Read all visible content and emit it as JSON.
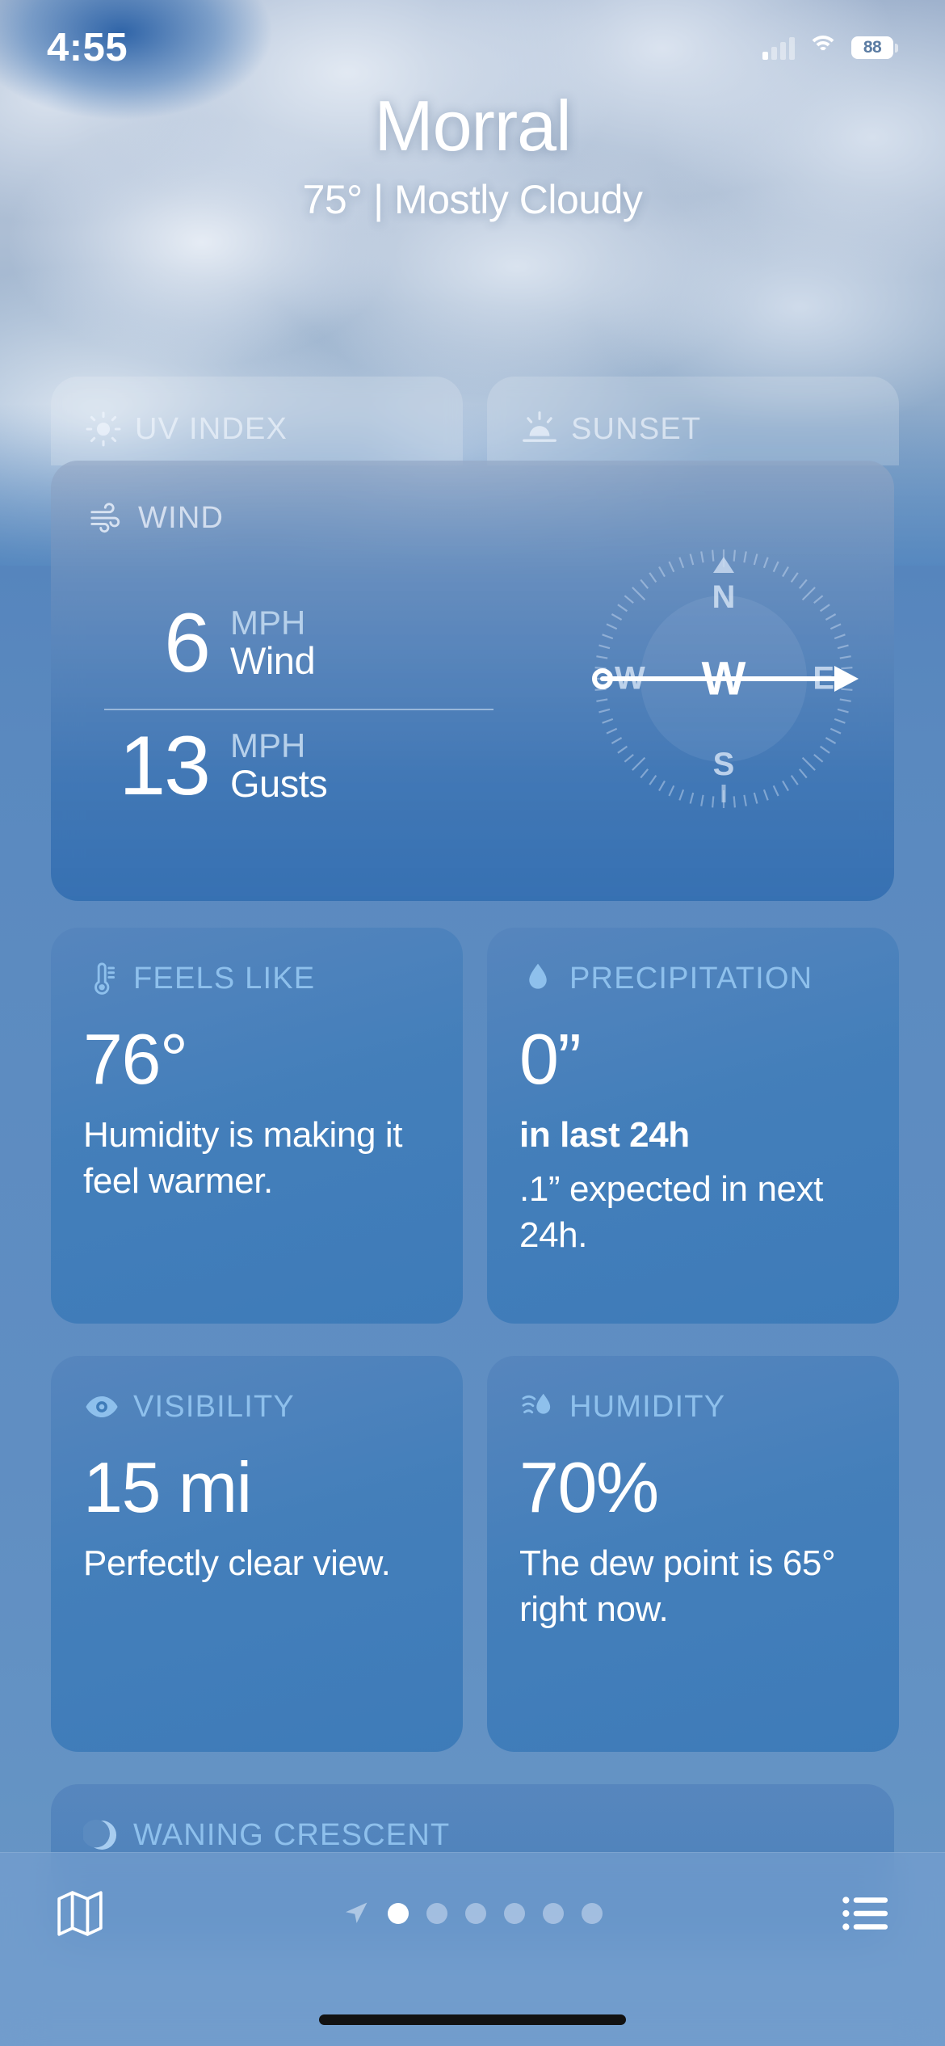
{
  "status_bar": {
    "time": "4:55",
    "battery_percent": "88",
    "cellular_icon": "cellular-signal-icon",
    "wifi_icon": "wifi-icon",
    "battery_icon": "battery-icon"
  },
  "header": {
    "city": "Morral",
    "conditions": "75° | Mostly Cloudy",
    "temperature": "75°",
    "summary": "Mostly Cloudy"
  },
  "top_cards": [
    {
      "label": "UV INDEX",
      "icon": "sun-max-icon"
    },
    {
      "label": "SUNSET",
      "icon": "sunset-icon"
    }
  ],
  "wind_card": {
    "label": "WIND",
    "icon": "wind-icon",
    "rows": [
      {
        "value": "6",
        "unit": "MPH",
        "kind": "Wind"
      },
      {
        "value": "13",
        "unit": "MPH",
        "kind": "Gusts"
      }
    ],
    "compass": {
      "north": "N",
      "south": "S",
      "west": "W",
      "east": "E",
      "center_direction": "W"
    }
  },
  "metrics": [
    {
      "label": "FEELS LIKE",
      "icon": "thermometer-icon",
      "value": "76°",
      "desc_bold": "",
      "desc": "Humidity is making it feel warmer."
    },
    {
      "label": "PRECIPITATION",
      "icon": "raindrop-icon",
      "value": "0”",
      "desc_bold": "in last 24h",
      "desc": ".1” expected in next 24h."
    },
    {
      "label": "VISIBILITY",
      "icon": "eye-icon",
      "value": "15 mi",
      "desc_bold": "",
      "desc": "Perfectly clear view."
    },
    {
      "label": "HUMIDITY",
      "icon": "humidity-icon",
      "value": "70%",
      "desc_bold": "",
      "desc": "The dew point is 65° right now."
    }
  ],
  "moon_card": {
    "label": "WANING CRESCENT",
    "icon": "moon-phase-icon"
  },
  "tab_bar": {
    "map_icon": "map-icon",
    "list_icon": "list-bullet-icon",
    "location_icon": "location-arrow-icon",
    "page_count": 6,
    "active_page": 1
  },
  "colors": {
    "accent_label": "#8ec0ec",
    "card_blue": "#427eba",
    "background_blue": "#5b8bc0",
    "text_white": "#ffffff"
  }
}
